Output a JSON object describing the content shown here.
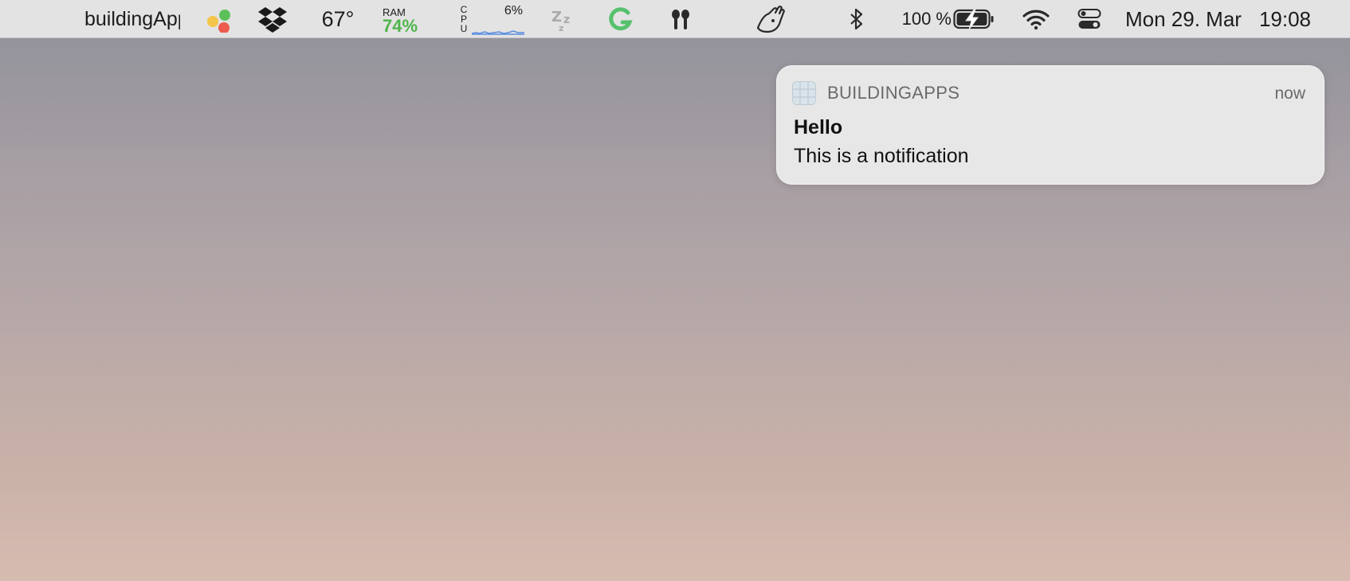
{
  "menubar": {
    "app_name": "buildingApps",
    "temperature": "67°",
    "ram": {
      "label": "RAM",
      "value": "74%"
    },
    "cpu": {
      "label_letters": "C\nP\nU",
      "value": "6%"
    },
    "battery": {
      "percent": "100 %"
    },
    "datetime": {
      "date": "Mon 29. Mar",
      "time": "19:08"
    },
    "icons": [
      "color-dots-icon",
      "dropbox-icon",
      "sleep-zzz-icon",
      "grammarly-icon",
      "airpods-icon",
      "hand-gesture-icon",
      "bluetooth-icon",
      "battery-charging-icon",
      "wifi-icon",
      "control-center-icon"
    ],
    "colors": {
      "ram_value": "#4fb54b",
      "grammarly": "#57c16e",
      "cpu_graph": "#5a8de0"
    }
  },
  "notification": {
    "app_name": "BUILDINGAPPS",
    "time": "now",
    "title": "Hello",
    "body": "This is a notification"
  }
}
